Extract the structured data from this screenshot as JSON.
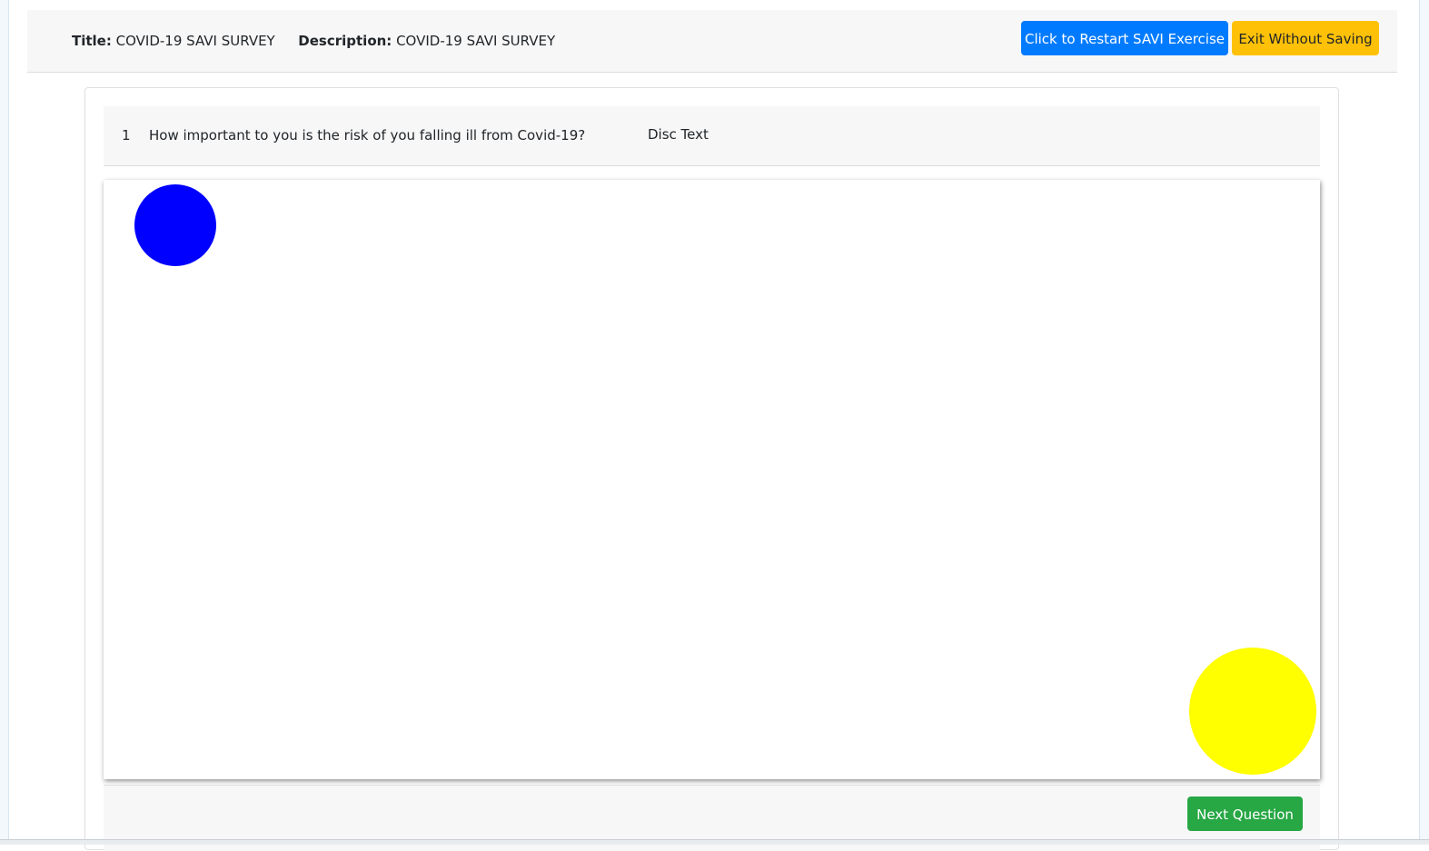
{
  "header": {
    "title_label": "Title:",
    "title_value": "COVID-19 SAVI SURVEY",
    "description_label": "Description:",
    "description_value": "COVID-19 SAVI SURVEY",
    "restart_button": "Click to Restart SAVI Exercise",
    "exit_button": "Exit Without Saving"
  },
  "question": {
    "number": "1",
    "text": "How important to you is the risk of you falling ill from Covid-19?",
    "disc_text": "Disc Text"
  },
  "canvas": {
    "discs": [
      {
        "color": "#0000ff"
      },
      {
        "color": "#ffff00"
      }
    ]
  },
  "footer": {
    "next_button": "Next Question"
  },
  "colors": {
    "primary": "#007bff",
    "warning": "#ffc107",
    "success": "#28a745"
  }
}
